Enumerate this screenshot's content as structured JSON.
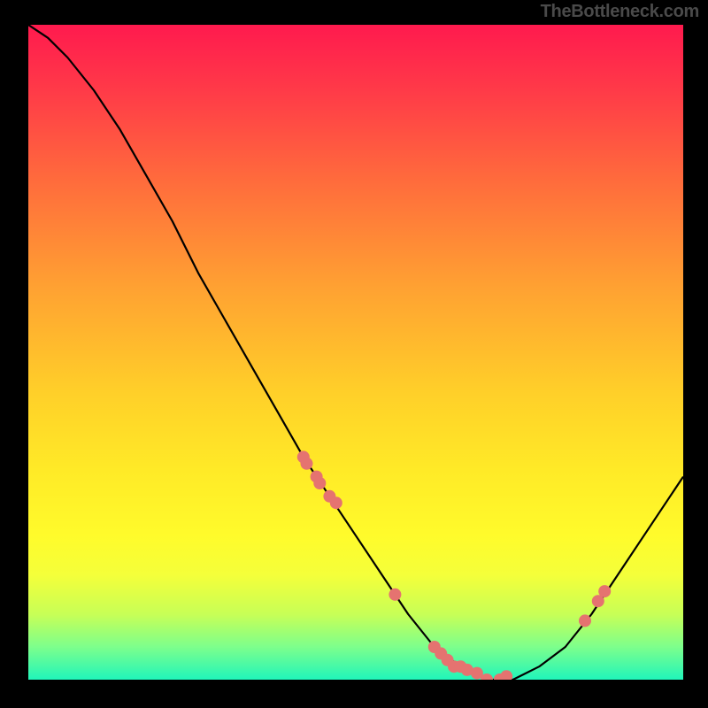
{
  "watermark": "TheBottleneck.com",
  "chart_data": {
    "type": "line",
    "title": "",
    "xlabel": "",
    "ylabel": "",
    "xlim": [
      0,
      100
    ],
    "ylim": [
      0,
      100
    ],
    "curve": {
      "name": "bottleneck-curve",
      "x": [
        0,
        3,
        6,
        10,
        14,
        18,
        22,
        26,
        30,
        34,
        38,
        42,
        46,
        50,
        54,
        58,
        62,
        66,
        70,
        74,
        78,
        82,
        86,
        90,
        94,
        98,
        100
      ],
      "y": [
        100,
        98,
        95,
        90,
        84,
        77,
        70,
        62,
        55,
        48,
        41,
        34,
        28,
        22,
        16,
        10,
        5,
        2,
        0,
        0,
        2,
        5,
        10,
        16,
        22,
        28,
        31
      ]
    },
    "markers": {
      "name": "data-points",
      "color": "#e57370",
      "x": [
        42,
        42.5,
        44,
        44.5,
        46,
        47,
        56,
        62,
        63,
        64,
        65,
        66,
        67,
        68.5,
        70,
        72,
        73,
        85,
        87,
        88
      ],
      "y": [
        34,
        33,
        31,
        30,
        28,
        27,
        13,
        5,
        4,
        3,
        2,
        2,
        1.5,
        1,
        0,
        0,
        0.5,
        9,
        12,
        13.5
      ]
    }
  }
}
